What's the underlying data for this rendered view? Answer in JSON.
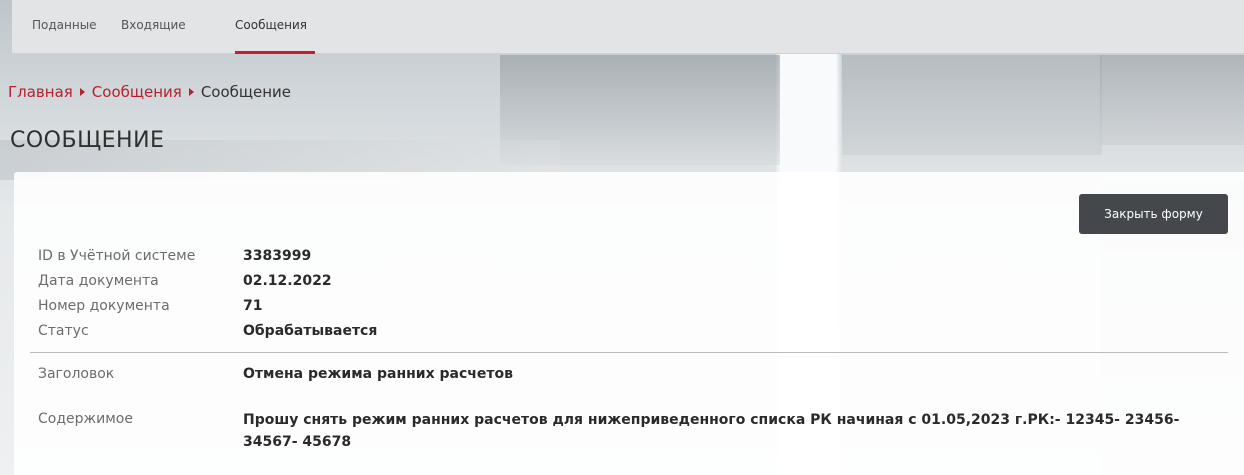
{
  "tabs": [
    {
      "label": "Поданные"
    },
    {
      "label": "Входящие"
    },
    {
      "label": "Сообщения"
    }
  ],
  "breadcrumb": {
    "home": "Главная",
    "section": "Сообщения",
    "current": "Сообщение"
  },
  "page_title": "СООБЩЕНИЕ",
  "close_button": "Закрыть форму",
  "fields": {
    "id_label": "ID в Учётной системе",
    "id_value": "3383999",
    "date_label": "Дата документа",
    "date_value": "02.12.2022",
    "number_label": "Номер документа",
    "number_value": "71",
    "status_label": "Статус",
    "status_value": "Обрабатывается",
    "subject_label": "Заголовок",
    "subject_value": "Отмена режима ранних расчетов",
    "content_label": "Содержимое",
    "content_value": "Прошу снять режим ранних расчетов для нижеприведенного списка РК начиная с 01.05,2023 г.РК:- 12345- 23456- 34567- 45678"
  },
  "colors": {
    "accent": "#c01f2b",
    "button": "#44484c"
  }
}
